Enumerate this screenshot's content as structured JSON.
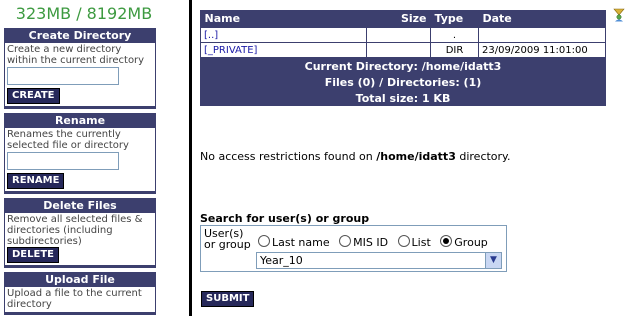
{
  "sidebar": {
    "quota": "323MB / 8192MB",
    "create": {
      "title": "Create Directory",
      "desc": "Create a new directory within the current directory",
      "input_value": "",
      "button": "CREATE"
    },
    "rename": {
      "title": "Rename",
      "desc": "Renames the currently selected file or directory",
      "input_value": "",
      "button": "RENAME"
    },
    "delete": {
      "title": "Delete Files",
      "desc": "Remove all selected files & directories (including subdirectories)",
      "button": "DELETE"
    },
    "upload": {
      "title": "Upload File",
      "desc": "Upload a file to the current directory"
    }
  },
  "files": {
    "headers": {
      "name": "Name",
      "size": "Size",
      "type": "Type",
      "date": "Date"
    },
    "rows": [
      {
        "name": "[..]",
        "size": "",
        "type": ".",
        "date": ""
      },
      {
        "name": "[_PRIVATE]",
        "size": "",
        "type": "DIR",
        "date": "23/09/2009 11:01:00"
      }
    ],
    "current_dir": "Current Directory: /home/idatt3",
    "counts": "Files (0) / Directories: (1)",
    "total": "Total size: 1 KB"
  },
  "access": {
    "prefix": "No access restrictions found on ",
    "path": "/home/idatt3",
    "suffix": " directory."
  },
  "search": {
    "title": "Search for user(s) or group",
    "label": "User(s) or group",
    "options": [
      "Last name",
      "MIS ID",
      "List",
      "Group"
    ],
    "selected_option": "Group",
    "group_value": "Year_10",
    "submit": "SUBMIT"
  },
  "icons": {
    "corner": "user-group-icon",
    "dropdown": "chevron-down-icon"
  },
  "colors": {
    "panel": "#3c3f6e",
    "button": "#26285a",
    "quota": "#3d9a40",
    "link": "#1a1aa6"
  }
}
